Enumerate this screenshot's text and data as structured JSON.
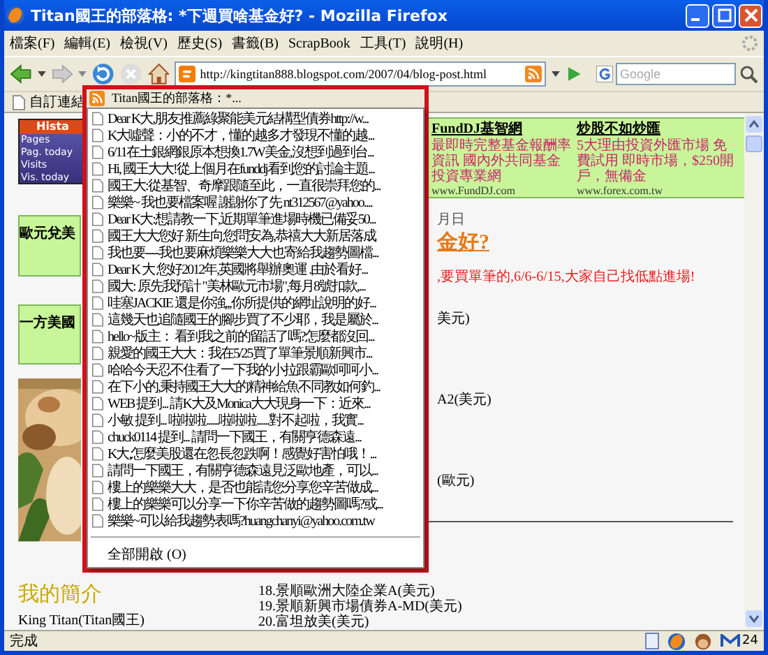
{
  "window": {
    "title": "Titan國王的部落格: *下週買啥基金好? - Mozilla Firefox"
  },
  "menu_bar": [
    "檔案(F)",
    "編輯(E)",
    "檢視(V)",
    "歷史(S)",
    "書籤(B)",
    "ScrapBook",
    "工具(T)",
    "說明(H)"
  ],
  "address_bar": {
    "url": "http://kingtitan888.blogspot.com/2007/04/blog-post.html"
  },
  "search": {
    "placeholder": "Google"
  },
  "bookmarks_bar": [
    {
      "label": "自訂連結"
    }
  ],
  "feed_menu": {
    "title": "Titan國王的部落格：*...",
    "items": [
      "Dear K大,朋友推薦綠聚能美元結構型債券http://w...",
      "K大噓聲：小的不才，懂的越多才發現不懂的越...",
      "6/11在土銀網銀原本想換1.7W美金,沒想到過到台...",
      "Hi, 國王大大!從上個月在funddj看到您的討論主題...",
      "國王大:從基智、奇摩跟隨至此，一直很崇拜您的...",
      "樂樂~ 我也要檔案喔 謝謝你了先 nt312567@yahoo....",
      "Dear K大:想請教一下,近期單筆進場時機已備妥50...",
      "國王大大您好 新生向您問安為,恭禧大大新居落成",
      "我也要----我也要麻煩樂樂大大也寄給我趨勢圖檔...",
      "Dear K 大 您好2012年,英國將舉辦奧運 .由於看好...",
      "國大: 原先我預計 \"美林歐元市場\",每月8號扣款,...",
      "哇塞JACKIE 還是你強,,,你所提供的網址說明的好...",
      "這幾天也追隨國王的腳步買了不少耶，我是屬於...",
      "hello~版主： 看到我之前的留話了嗎?怎麼都沒回...",
      "親愛的國王大大：我在5/25買了單筆景順新興市...",
      "哈哈今天忍不住看了一下我的小拉跟霸歐呵呵小...",
      "在下小的,秉持國王大大的精神給魚不同教如何釣...",
      "WEB 提到... 請K大及Monica大大現身一下：近來...",
      "小敏 提到... 啦啦啦......啦啦啦......對不起啦，我實...",
      "chuck0114 提到... 請問一下國王，有關亨德森遠...",
      "K大,怎麼美股還在忽長忽跌啊！感覺好害怕哦！...",
      "請問一下國王，有關亨德森遠見泛歐地產，可以...",
      "樓上的樂樂大大，是否也能請您分享您辛苦做成...",
      "樓上的樂樂可以分享一下你辛苦做的趨勢圖嗎?或...",
      "樂樂~可以給我趨勢表嗎?huangchanyi@yahoo.com.tw"
    ],
    "open_all": "全部開啟 (O)"
  },
  "sidebar": {
    "counter": {
      "title": "Hista",
      "rows": [
        "Pages",
        "Pag. today",
        "Visits",
        "Vis. today"
      ]
    },
    "ads": [
      "歐元兌美",
      "一方美國"
    ],
    "picture": {
      "kind": "picture"
    },
    "profile_heading": "我的簡介",
    "profile_name": "King Titan(Titan國王)"
  },
  "post": {
    "ads": [
      {
        "title": "FundDJ基智網",
        "text": "最即時完整基金報酬率資訊 國內外共同基金投資專業網",
        "url": "www.FundDJ.com"
      },
      {
        "title": "炒股不如炒匯",
        "text": "5大理由投資外匯市場 免費試用 即時市場，$250開戶，無備金",
        "url": "www.forex.com.tw"
      }
    ],
    "date": "月日",
    "title": "金好?",
    "highlight": ",要買單筆的,6/6-6/15,大家自己找低點進場!",
    "fragments": [
      "美元)",
      "A2(美元)",
      "(歐元)"
    ],
    "list": [
      "18.景順歐洲大陸企業A(美元)",
      "19.景順新興市場債券A-MD(美元)",
      "20.富坦放美(美元)"
    ]
  },
  "status_bar": {
    "text": "完成",
    "mail_count": "24"
  }
}
